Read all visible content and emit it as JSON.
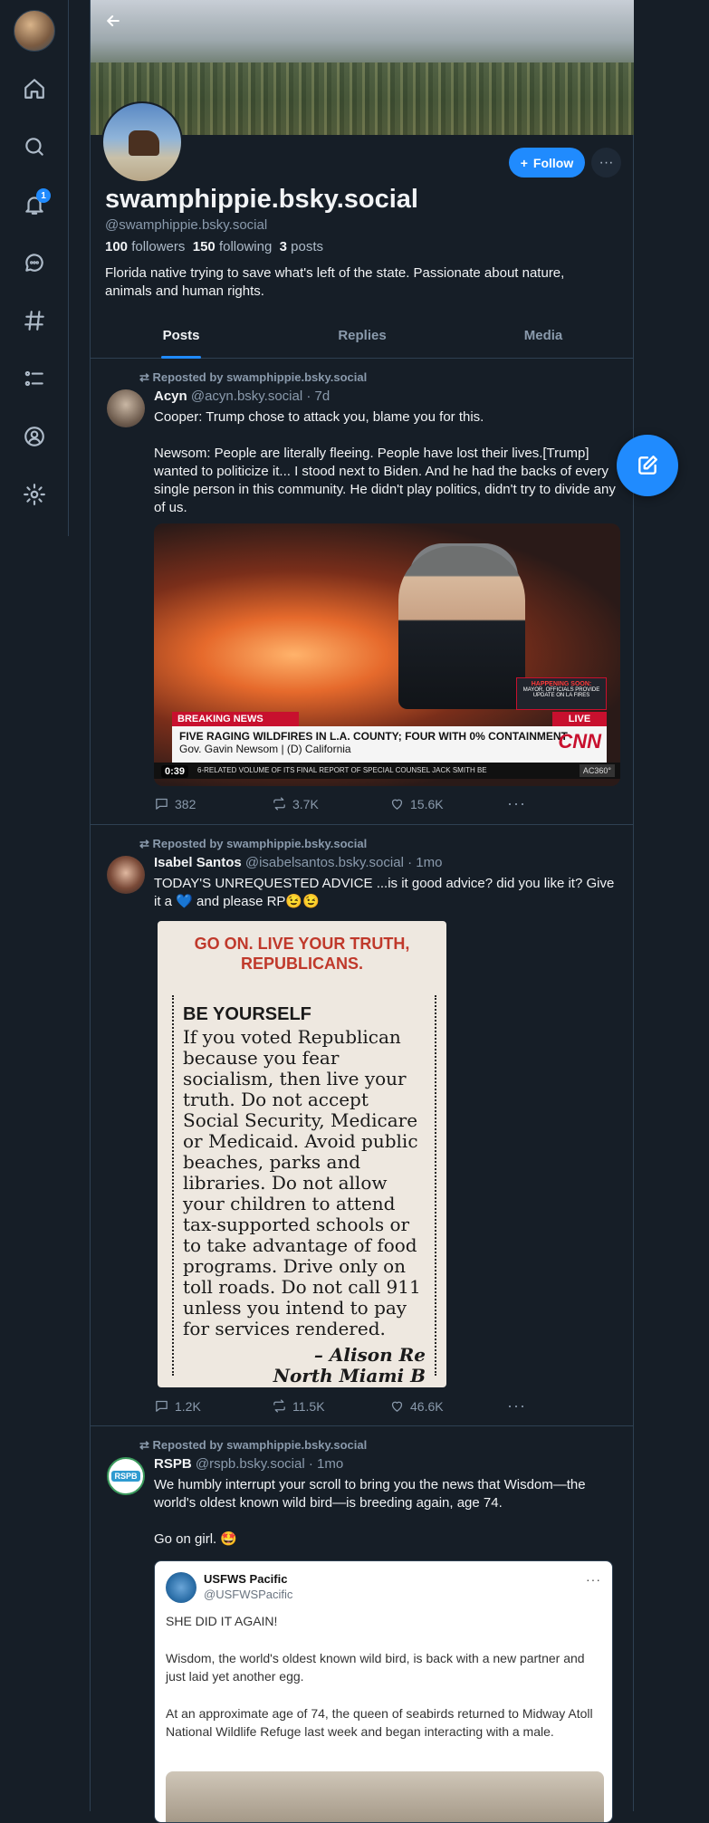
{
  "nav": {
    "notification_count": "1",
    "items": [
      "home-icon",
      "search-icon",
      "bell-icon",
      "chat-icon",
      "hash-icon",
      "list-icon",
      "profile-icon",
      "gear-icon"
    ]
  },
  "profile": {
    "display_name": "swamphippie.bsky.social",
    "handle": "@swamphippie.bsky.social",
    "followers_count": "100",
    "followers_label": "followers",
    "following_count": "150",
    "following_label": "following",
    "posts_count": "3",
    "posts_label": "posts",
    "bio": "Florida native trying to save what's left of the state. Passionate about nature, animals and human rights.",
    "follow_label": "Follow",
    "more_label": "···"
  },
  "tabs": [
    {
      "label": "Posts",
      "active": true
    },
    {
      "label": "Replies",
      "active": false
    },
    {
      "label": "Media",
      "active": false
    }
  ],
  "posts": [
    {
      "repost_label": "Reposted by swamphippie.bsky.social",
      "author": "Acyn",
      "handle": "@acyn.bsky.social",
      "time": "· 7d",
      "text": "Cooper: Trump chose to attack you, blame you for this.\n\nNewsom: People are literally fleeing. People have lost their lives.[Trump] wanted to politicize it... I stood next to Biden. And he had the backs of every single person in this community. He didn't play politics, didn't try to divide any of us.",
      "video": {
        "breaking": "BREAKING NEWS",
        "live": "LIVE",
        "happening_title": "HAPPENING SOON:",
        "happening_text": "MAYOR, OFFICIALS PROVIDE UPDATE ON LA FIRES",
        "headline": "FIVE RAGING WILDFIRES IN L.A. COUNTY; FOUR WITH 0% CONTAINMENT",
        "subline": "Gov. Gavin Newsom  |  (D) California",
        "network": "CNN",
        "ticker": "6-RELATED VOLUME OF ITS FINAL REPORT OF SPECIAL COUNSEL JACK SMITH BE",
        "timecode": "0:39",
        "show": "AC360°"
      },
      "replies": "382",
      "reposts": "3.7K",
      "likes": "15.6K"
    },
    {
      "repost_label": "Reposted by swamphippie.bsky.social",
      "author": "Isabel Santos",
      "handle": "@isabelsantos.bsky.social",
      "time": "· 1mo",
      "text": "TODAY'S UNREQUESTED ADVICE ...is it good advice? did you like it? Give it a 💙 and please RP😉😉",
      "clipping": {
        "headline": "GO ON. LIVE YOUR TRUTH, REPUBLICANS.",
        "title": "BE YOURSELF",
        "body": "If you voted Republican because you fear socialism, then live your truth. Do not accept Social Security, Medicare or Medicaid. Avoid public beaches, parks and libraries. Do not allow your children to attend tax-supported schools or to take advantage of food programs. Drive only on toll roads. Do not call 911 unless you intend to pay for services rendered.",
        "signature_1": "– Alison Re",
        "signature_2": "North Miami B"
      },
      "replies": "1.2K",
      "reposts": "11.5K",
      "likes": "46.6K"
    },
    {
      "repost_label": "Reposted by swamphippie.bsky.social",
      "author": "RSPB",
      "handle": "@rspb.bsky.social",
      "time": "· 1mo",
      "text": "We humbly interrupt your scroll to bring you the news that Wisdom—the world's oldest known wild bird—is breeding again, age 74.\n\nGo on girl. 🤩",
      "avatar_text": "RSPB",
      "quote": {
        "name": "USFWS Pacific",
        "handle": "@USFWSPacific",
        "more": "···",
        "para1": "SHE DID IT AGAIN!",
        "para2": "Wisdom, the world's oldest known wild bird, is back with a new partner and just laid yet another egg.",
        "para3": "At an approximate age of 74, the queen of seabirds returned to Midway Atoll National Wildlife Refuge last week and began interacting with a male."
      }
    }
  ],
  "colors": {
    "background": "#161e27",
    "accent": "#208bfe",
    "border": "#2e4052",
    "muted": "#8a9aac"
  }
}
